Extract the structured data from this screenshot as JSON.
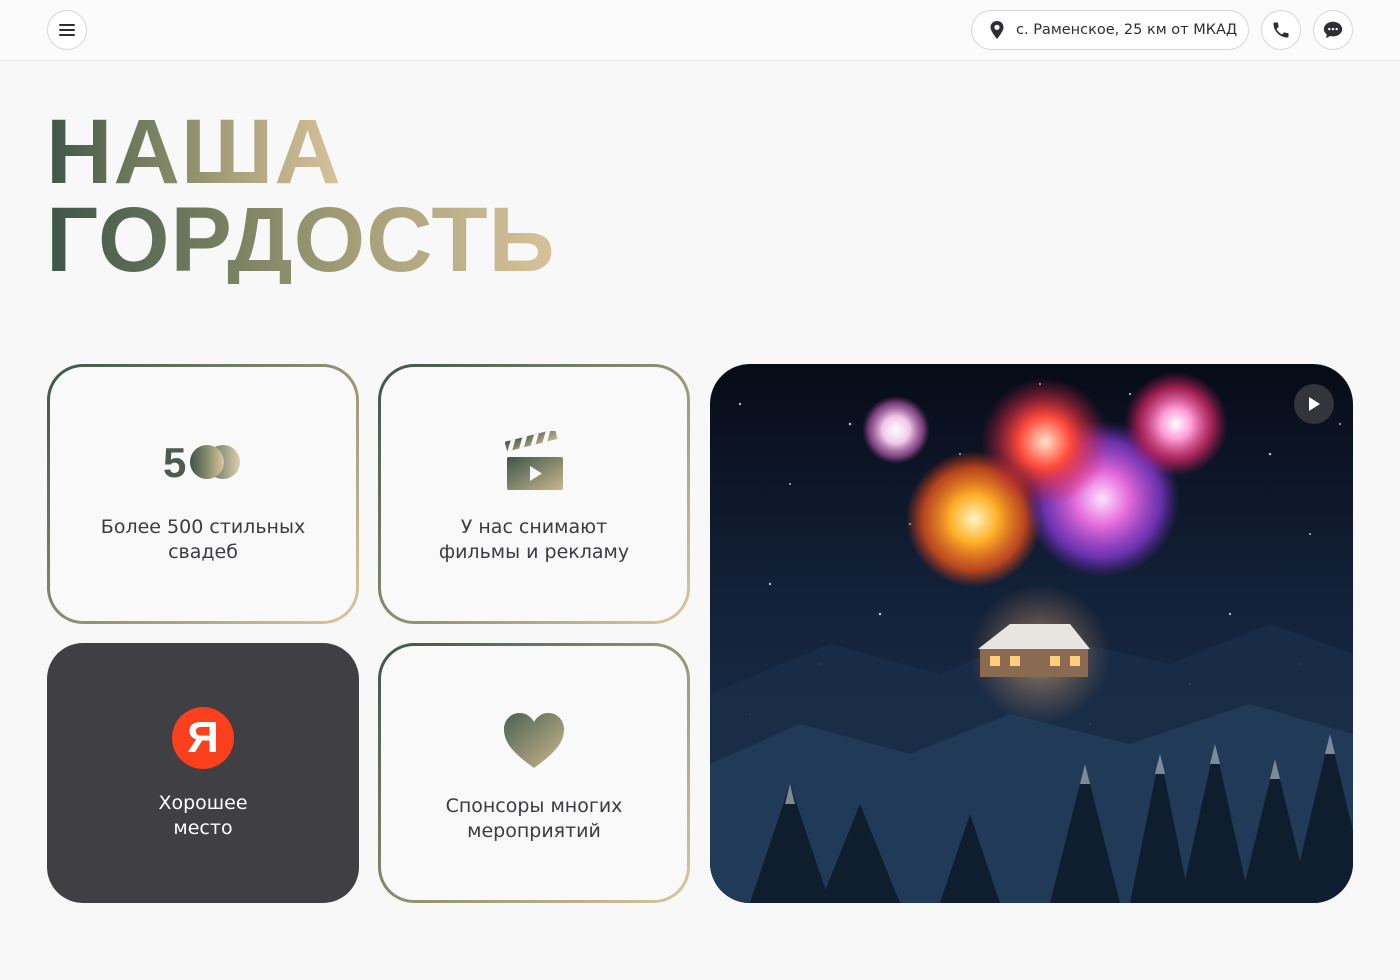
{
  "header": {
    "location": "с. Раменское, 25 км от МКАД",
    "icons": {
      "menu": "menu-icon",
      "location": "location-pin-icon",
      "phone": "phone-icon",
      "chat": "chat-icon"
    }
  },
  "page": {
    "title_line1": "НАША",
    "title_line2": "ГОРДОСТЬ"
  },
  "cards": [
    {
      "icon": "500-icon",
      "icon_text": "500",
      "caption_line1": "Более 500 стильных",
      "caption_line2": "свадеб",
      "style": "outline"
    },
    {
      "icon": "clapperboard-icon",
      "caption_line1": "У нас снимают",
      "caption_line2": "фильмы и рекламу",
      "style": "outline"
    },
    {
      "icon": "yandex-logo-icon",
      "icon_text": "Я",
      "caption_line1": "Хорошее",
      "caption_line2": "место",
      "style": "dark"
    },
    {
      "icon": "heart-icon",
      "caption_line1": "Спонсоры многих",
      "caption_line2": "мероприятий",
      "style": "outline"
    }
  ],
  "video": {
    "scene": "fireworks-over-snowy-forest",
    "play_icon": "play-icon"
  },
  "colors": {
    "gradient_start": "#3d5548",
    "gradient_end": "#d8c29a",
    "dark_card": "#3f3f44",
    "yandex_red": "#fc3f1d",
    "background": "#f8f8f8"
  }
}
